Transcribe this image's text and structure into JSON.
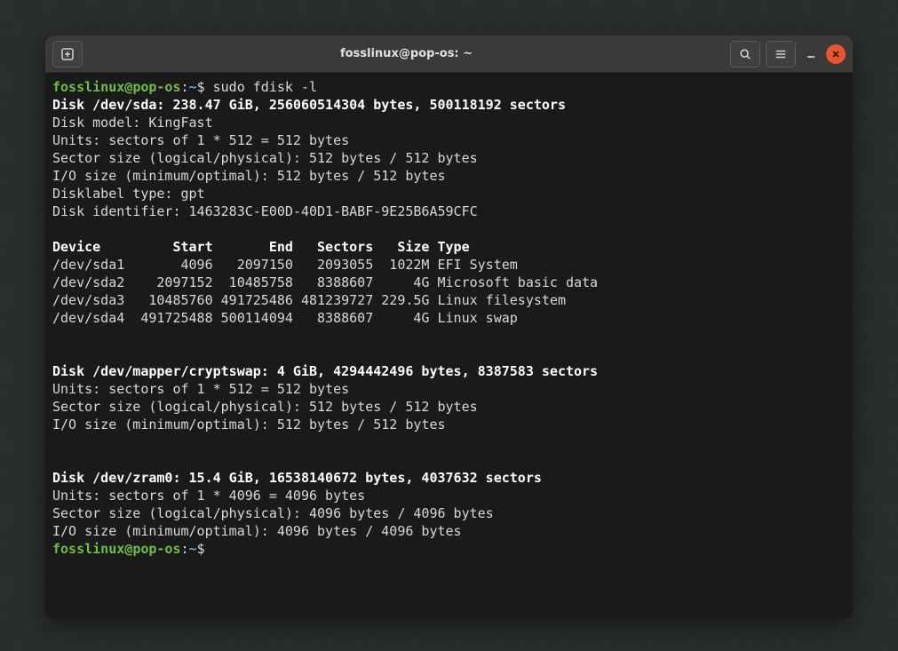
{
  "title": "fosslinux@pop-os: ~",
  "prompt": {
    "user": "fosslinux",
    "at": "@",
    "host": "pop-os",
    "colon": ":",
    "path": "~",
    "dollar": "$"
  },
  "command": " sudo fdisk -l",
  "disk1": {
    "header": "Disk /dev/sda: 238.47 GiB, 256060514304 bytes, 500118192 sectors",
    "model": "Disk model: KingFast",
    "units": "Units: sectors of 1 * 512 = 512 bytes",
    "sector": "Sector size (logical/physical): 512 bytes / 512 bytes",
    "io": "I/O size (minimum/optimal): 512 bytes / 512 bytes",
    "label": "Disklabel type: gpt",
    "ident": "Disk identifier: 1463283C-E00D-40D1-BABF-9E25B6A59CFC",
    "tableHeader": "Device         Start       End   Sectors   Size Type",
    "rows": [
      "/dev/sda1       4096   2097150   2093055  1022M EFI System",
      "/dev/sda2    2097152  10485758   8388607     4G Microsoft basic data",
      "/dev/sda3   10485760 491725486 481239727 229.5G Linux filesystem",
      "/dev/sda4  491725488 500114094   8388607     4G Linux swap"
    ]
  },
  "disk2": {
    "header": "Disk /dev/mapper/cryptswap: 4 GiB, 4294442496 bytes, 8387583 sectors",
    "units": "Units: sectors of 1 * 512 = 512 bytes",
    "sector": "Sector size (logical/physical): 512 bytes / 512 bytes",
    "io": "I/O size (minimum/optimal): 512 bytes / 512 bytes"
  },
  "disk3": {
    "header": "Disk /dev/zram0: 15.4 GiB, 16538140672 bytes, 4037632 sectors",
    "units": "Units: sectors of 1 * 4096 = 4096 bytes",
    "sector": "Sector size (logical/physical): 4096 bytes / 4096 bytes",
    "io": "I/O size (minimum/optimal): 4096 bytes / 4096 bytes"
  }
}
